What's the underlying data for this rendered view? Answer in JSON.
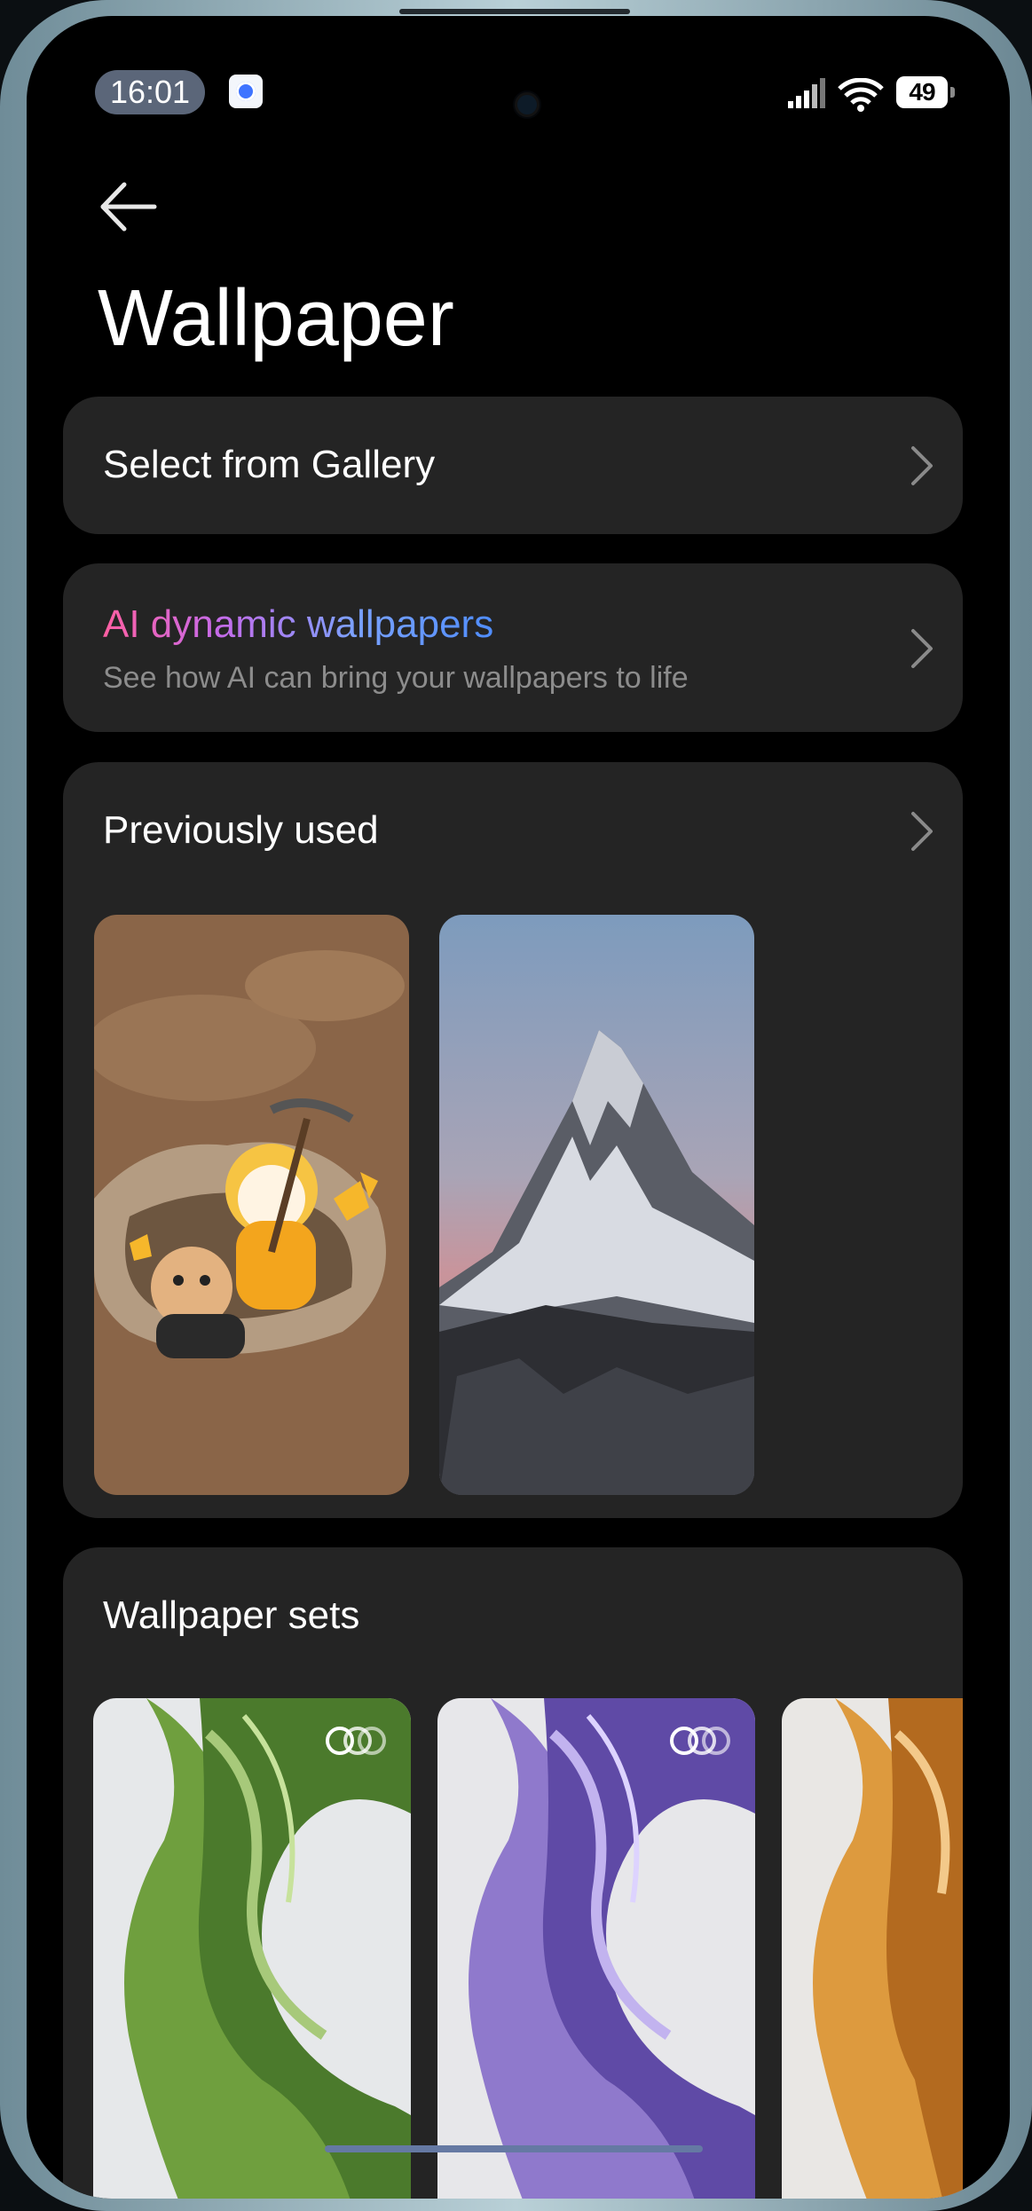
{
  "status_bar": {
    "time": "16:01",
    "battery": "49",
    "icons": [
      "settings-notification-icon",
      "signal-icon",
      "wifi-icon",
      "battery-icon"
    ]
  },
  "header": {
    "back_icon": "arrow-left-icon",
    "title": "Wallpaper"
  },
  "gallery": {
    "label": "Select from Gallery"
  },
  "ai": {
    "title": "AI dynamic wallpapers",
    "subtitle": "See how AI can bring your wallpapers to life"
  },
  "previous": {
    "label": "Previously used",
    "items": [
      {
        "name": "cartoon-bears-mining-wallpaper"
      },
      {
        "name": "snowy-mountain-peak-wallpaper"
      }
    ]
  },
  "sets": {
    "label": "Wallpaper sets",
    "items": [
      {
        "name": "green-abstract-set",
        "color": "#7fb35c"
      },
      {
        "name": "purple-abstract-set",
        "color": "#8b73c9"
      },
      {
        "name": "orange-abstract-set",
        "color": "#e0a24a"
      }
    ]
  },
  "colors": {
    "card_bg": "#242424",
    "screen_bg": "#000000",
    "time_pill": "#5b6679"
  }
}
